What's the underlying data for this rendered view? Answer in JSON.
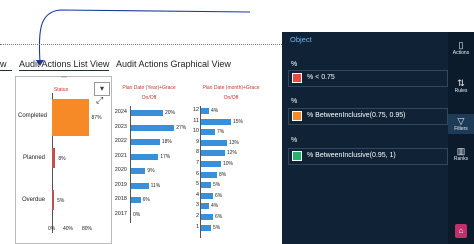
{
  "tabs": {
    "summary_label": "w",
    "list_view_label": "Audit Actions List View",
    "graphical_view_label": "Audit Actions Graphical View"
  },
  "status_card": {
    "title": "Status",
    "categories": [
      {
        "label": "Completed",
        "value_label": "87%",
        "value": 87,
        "color": "#f58a26"
      },
      {
        "label": "Planned",
        "value_label": "8%",
        "value": 8,
        "color": "#c0504d"
      },
      {
        "label": "Overdue",
        "value_label": "5%",
        "value": 5,
        "color": "#c0504d"
      }
    ],
    "axis_ticks": [
      "0%",
      "40%",
      "80%"
    ]
  },
  "year_chart": {
    "title_line1": "Plan Date (Year)+Grace",
    "title_line2": "On/Off",
    "rows": [
      {
        "year": "2024",
        "value": 20,
        "value_label": "20%"
      },
      {
        "year": "2023",
        "value": 27,
        "value_label": "27%"
      },
      {
        "year": "2022",
        "value": 18,
        "value_label": "18%"
      },
      {
        "year": "2021",
        "value": 17,
        "value_label": "17%"
      },
      {
        "year": "2020",
        "value": 9,
        "value_label": "9%"
      },
      {
        "year": "2019",
        "value": 11,
        "value_label": "11%"
      },
      {
        "year": "2018",
        "value": 6,
        "value_label": "6%"
      },
      {
        "year": "2017",
        "value": 0,
        "value_label": "0%"
      }
    ]
  },
  "month_chart": {
    "title_line1": "Plan Date (month)+Grace",
    "title_line2": "On/Off",
    "rows": [
      {
        "month": "12",
        "value": 4,
        "value_label": "4%"
      },
      {
        "month": "11",
        "value": 15,
        "value_label": "15%"
      },
      {
        "month": "10",
        "value": 7,
        "value_label": "7%"
      },
      {
        "month": "9",
        "value": 13,
        "value_label": "13%"
      },
      {
        "month": "8",
        "value": 12,
        "value_label": "12%"
      },
      {
        "month": "7",
        "value": 10,
        "value_label": "10%"
      },
      {
        "month": "6",
        "value": 8,
        "value_label": "8%"
      },
      {
        "month": "5",
        "value": 5,
        "value_label": "5%"
      },
      {
        "month": "4",
        "value": 6,
        "value_label": "6%"
      },
      {
        "month": "3",
        "value": 4,
        "value_label": "4%"
      },
      {
        "month": "2",
        "value": 6,
        "value_label": "6%"
      },
      {
        "month": "1",
        "value": 5,
        "value_label": "5%"
      }
    ]
  },
  "panel": {
    "header": "Object",
    "rules": [
      {
        "symbol": "%",
        "color": "#e84c3d",
        "label": "% < 0.75"
      },
      {
        "symbol": "%",
        "color": "#f58a26",
        "label": "% BetweenInclusive(0.75, 0.95)"
      },
      {
        "symbol": "%",
        "color": "#26b36b",
        "label": "% BetweenInclusive(0.95, 1)"
      }
    ]
  },
  "rail": [
    {
      "icon": "actions-icon",
      "label": "Actions"
    },
    {
      "icon": "rules-icon",
      "label": "Rules"
    },
    {
      "icon": "filters-icon",
      "label": "Filters"
    },
    {
      "icon": "ranks-icon",
      "label": "Ranks"
    }
  ]
}
